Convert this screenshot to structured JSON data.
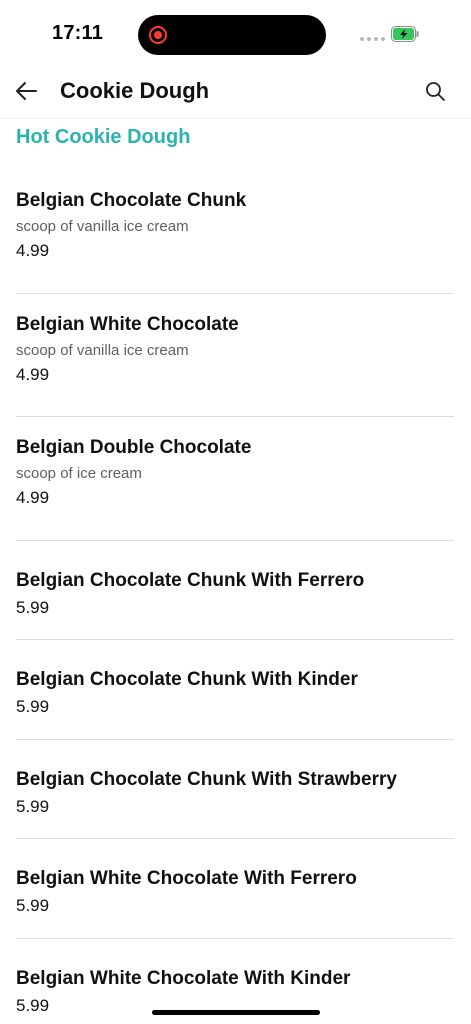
{
  "status_bar": {
    "time": "17:11",
    "battery_color": "#34c759"
  },
  "header": {
    "title": "Cookie Dough",
    "back_icon": "arrow-left-icon",
    "search_icon": "search-icon"
  },
  "section": {
    "title": "Hot Cookie Dough",
    "accent_color": "#2bb3b1"
  },
  "items": [
    {
      "name": "Belgian Chocolate Chunk",
      "description": "scoop of vanilla ice cream",
      "price": "4.99"
    },
    {
      "name": "Belgian White Chocolate",
      "description": "scoop of vanilla ice cream",
      "price": "4.99"
    },
    {
      "name": "Belgian Double Chocolate",
      "description": "scoop of ice cream",
      "price": "4.99"
    },
    {
      "name": "Belgian Chocolate Chunk With Ferrero",
      "description": "",
      "price": "5.99"
    },
    {
      "name": "Belgian Chocolate Chunk With Kinder",
      "description": "",
      "price": "5.99"
    },
    {
      "name": "Belgian Chocolate Chunk With Strawberry",
      "description": "",
      "price": "5.99"
    },
    {
      "name": "Belgian White Chocolate With Ferrero",
      "description": "",
      "price": "5.99"
    },
    {
      "name": "Belgian White Chocolate With Kinder",
      "description": "",
      "price": "5.99"
    }
  ]
}
